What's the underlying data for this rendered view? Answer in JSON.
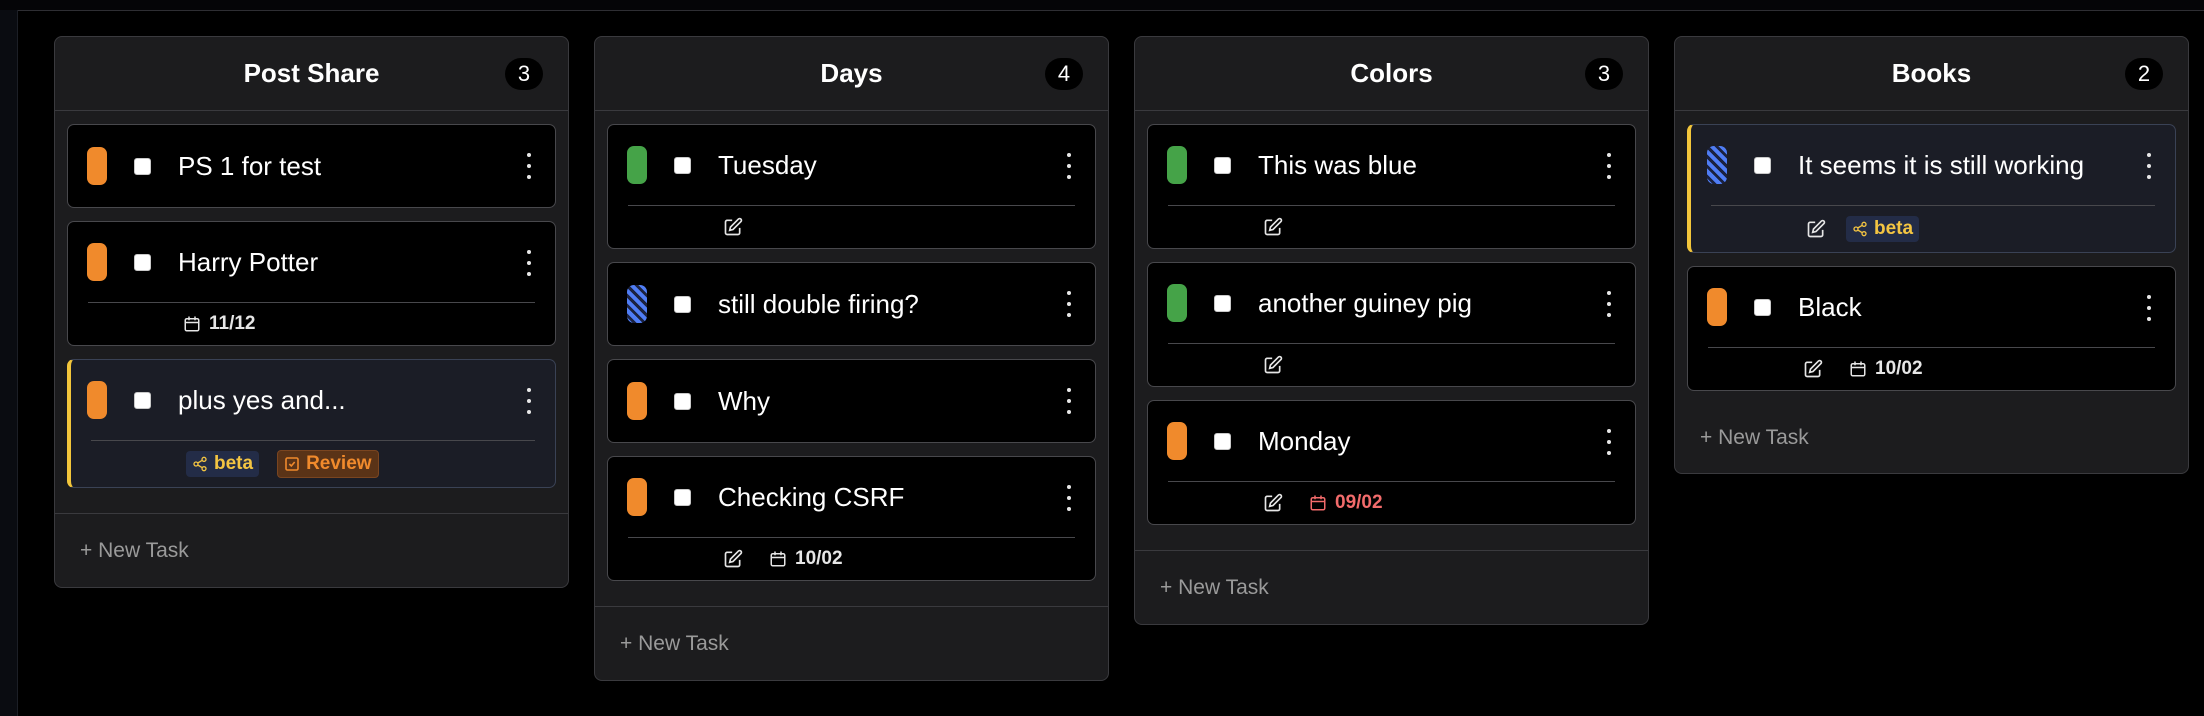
{
  "columns": [
    {
      "title": "Post Share",
      "count": "3",
      "new_task_label": "+ New Task",
      "tasks": [
        {
          "title": "PS 1 for test",
          "status_color": "orange"
        },
        {
          "title": "Harry Potter",
          "status_color": "orange",
          "date": "11/12"
        },
        {
          "title": "plus yes and...",
          "status_color": "orange",
          "highlighted": true,
          "tags": [
            {
              "label": "beta",
              "type": "beta"
            },
            {
              "label": "Review",
              "type": "review"
            }
          ]
        }
      ]
    },
    {
      "title": "Days",
      "count": "4",
      "new_task_label": "+ New Task",
      "tasks": [
        {
          "title": "Tuesday",
          "status_color": "green",
          "has_edit": true
        },
        {
          "title": "still double firing?",
          "status_color": "striped-blue"
        },
        {
          "title": "Why",
          "status_color": "orange"
        },
        {
          "title": "Checking CSRF",
          "status_color": "orange",
          "has_edit": true,
          "date": "10/02"
        }
      ]
    },
    {
      "title": "Colors",
      "count": "3",
      "new_task_label": "+ New Task",
      "tasks": [
        {
          "title": "This was blue",
          "status_color": "green",
          "has_edit": true
        },
        {
          "title": "another guiney pig",
          "status_color": "green",
          "has_edit": true
        },
        {
          "title": "Monday",
          "status_color": "orange",
          "has_edit": true,
          "date": "09/02",
          "date_overdue": true
        }
      ]
    },
    {
      "title": "Books",
      "count": "2",
      "new_task_label": "+ New Task",
      "tasks": [
        {
          "title": "It seems it is still working",
          "status_color": "striped-blue",
          "highlighted": true,
          "has_edit": true,
          "tags": [
            {
              "label": "beta",
              "type": "beta"
            }
          ]
        },
        {
          "title": "Black",
          "status_color": "orange",
          "has_edit": true,
          "date": "10/02"
        }
      ]
    }
  ],
  "colors": {
    "orange": "#f08a2c",
    "green": "#45a348",
    "blue": "#4f7df5",
    "highlight": "#f3c63b",
    "overdue": "#f26b6b",
    "tag_text": "#f4c542"
  }
}
